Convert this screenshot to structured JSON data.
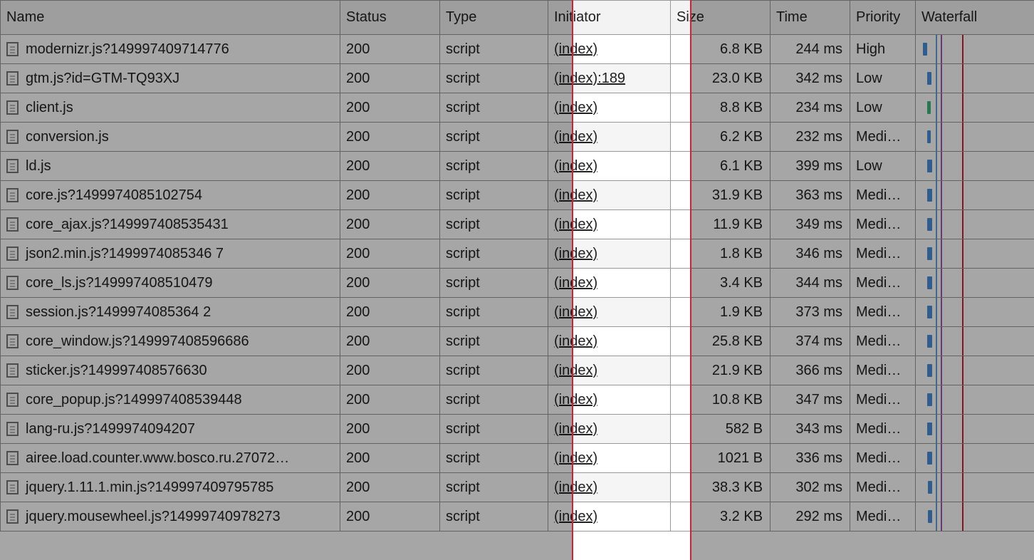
{
  "headers": {
    "name": "Name",
    "status": "Status",
    "type": "Type",
    "initiator": "Initiator",
    "size": "Size",
    "time": "Time",
    "priority": "Priority",
    "waterfall": "Waterfall"
  },
  "waterfall_guides": {
    "blue": 20,
    "purple": 27,
    "red": 57
  },
  "rows": [
    {
      "name": "modernizr.js?149997409714776",
      "status": "200",
      "type": "script",
      "initiator": "(index)",
      "size": "6.8 KB",
      "time": "244 ms",
      "priority": "High",
      "bar": {
        "x": 2,
        "w": 6,
        "color": "blue"
      }
    },
    {
      "name": "gtm.js?id=GTM-TQ93XJ",
      "status": "200",
      "type": "script",
      "initiator": "(index):189",
      "size": "23.0 KB",
      "time": "342 ms",
      "priority": "Low",
      "bar": {
        "x": 8,
        "w": 6,
        "color": "blue"
      }
    },
    {
      "name": "client.js",
      "status": "200",
      "type": "script",
      "initiator": "(index)",
      "size": "8.8 KB",
      "time": "234 ms",
      "priority": "Low",
      "bar": {
        "x": 8,
        "w": 5,
        "color": "green"
      }
    },
    {
      "name": "conversion.js",
      "status": "200",
      "type": "script",
      "initiator": "(index)",
      "size": "6.2 KB",
      "time": "232 ms",
      "priority": "Medi…",
      "bar": {
        "x": 8,
        "w": 5,
        "color": "blue"
      }
    },
    {
      "name": "ld.js",
      "status": "200",
      "type": "script",
      "initiator": "(index)",
      "size": "6.1 KB",
      "time": "399 ms",
      "priority": "Low",
      "bar": {
        "x": 8,
        "w": 7,
        "color": "blue"
      }
    },
    {
      "name": "core.js?1499974085102754",
      "status": "200",
      "type": "script",
      "initiator": "(index)",
      "size": "31.9 KB",
      "time": "363 ms",
      "priority": "Medi…",
      "bar": {
        "x": 8,
        "w": 7,
        "color": "blue"
      }
    },
    {
      "name": "core_ajax.js?149997408535431",
      "status": "200",
      "type": "script",
      "initiator": "(index)",
      "size": "11.9 KB",
      "time": "349 ms",
      "priority": "Medi…",
      "bar": {
        "x": 8,
        "w": 7,
        "color": "blue"
      }
    },
    {
      "name": "json2.min.js?1499974085346 7",
      "status": "200",
      "type": "script",
      "initiator": "(index)",
      "size": "1.8 KB",
      "time": "346 ms",
      "priority": "Medi…",
      "bar": {
        "x": 8,
        "w": 7,
        "color": "blue"
      }
    },
    {
      "name": "core_ls.js?149997408510479",
      "status": "200",
      "type": "script",
      "initiator": "(index)",
      "size": "3.4 KB",
      "time": "344 ms",
      "priority": "Medi…",
      "bar": {
        "x": 8,
        "w": 7,
        "color": "blue"
      }
    },
    {
      "name": "session.js?1499974085364 2",
      "status": "200",
      "type": "script",
      "initiator": "(index)",
      "size": "1.9 KB",
      "time": "373 ms",
      "priority": "Medi…",
      "bar": {
        "x": 8,
        "w": 7,
        "color": "blue"
      }
    },
    {
      "name": "core_window.js?149997408596686",
      "status": "200",
      "type": "script",
      "initiator": "(index)",
      "size": "25.8 KB",
      "time": "374 ms",
      "priority": "Medi…",
      "bar": {
        "x": 8,
        "w": 7,
        "color": "blue"
      }
    },
    {
      "name": "sticker.js?149997408576630",
      "status": "200",
      "type": "script",
      "initiator": "(index)",
      "size": "21.9 KB",
      "time": "366 ms",
      "priority": "Medi…",
      "bar": {
        "x": 8,
        "w": 7,
        "color": "blue"
      }
    },
    {
      "name": "core_popup.js?149997408539448",
      "status": "200",
      "type": "script",
      "initiator": "(index)",
      "size": "10.8 KB",
      "time": "347 ms",
      "priority": "Medi…",
      "bar": {
        "x": 8,
        "w": 7,
        "color": "blue"
      }
    },
    {
      "name": "lang-ru.js?1499974094207",
      "status": "200",
      "type": "script",
      "initiator": "(index)",
      "size": "582 B",
      "time": "343 ms",
      "priority": "Medi…",
      "bar": {
        "x": 8,
        "w": 7,
        "color": "blue"
      }
    },
    {
      "name": "airee.load.counter.www.bosco.ru.27072…",
      "status": "200",
      "type": "script",
      "initiator": "(index)",
      "size": "1021 B",
      "time": "336 ms",
      "priority": "Medi…",
      "bar": {
        "x": 8,
        "w": 7,
        "color": "blue"
      }
    },
    {
      "name": "jquery.1.11.1.min.js?149997409795785",
      "status": "200",
      "type": "script",
      "initiator": "(index)",
      "size": "38.3 KB",
      "time": "302 ms",
      "priority": "Medi…",
      "bar": {
        "x": 9,
        "w": 6,
        "color": "blue"
      }
    },
    {
      "name": "jquery.mousewheel.js?14999740978273",
      "status": "200",
      "type": "script",
      "initiator": "(index)",
      "size": "3.2 KB",
      "time": "292 ms",
      "priority": "Medi…",
      "bar": {
        "x": 9,
        "w": 6,
        "color": "blue"
      }
    }
  ]
}
